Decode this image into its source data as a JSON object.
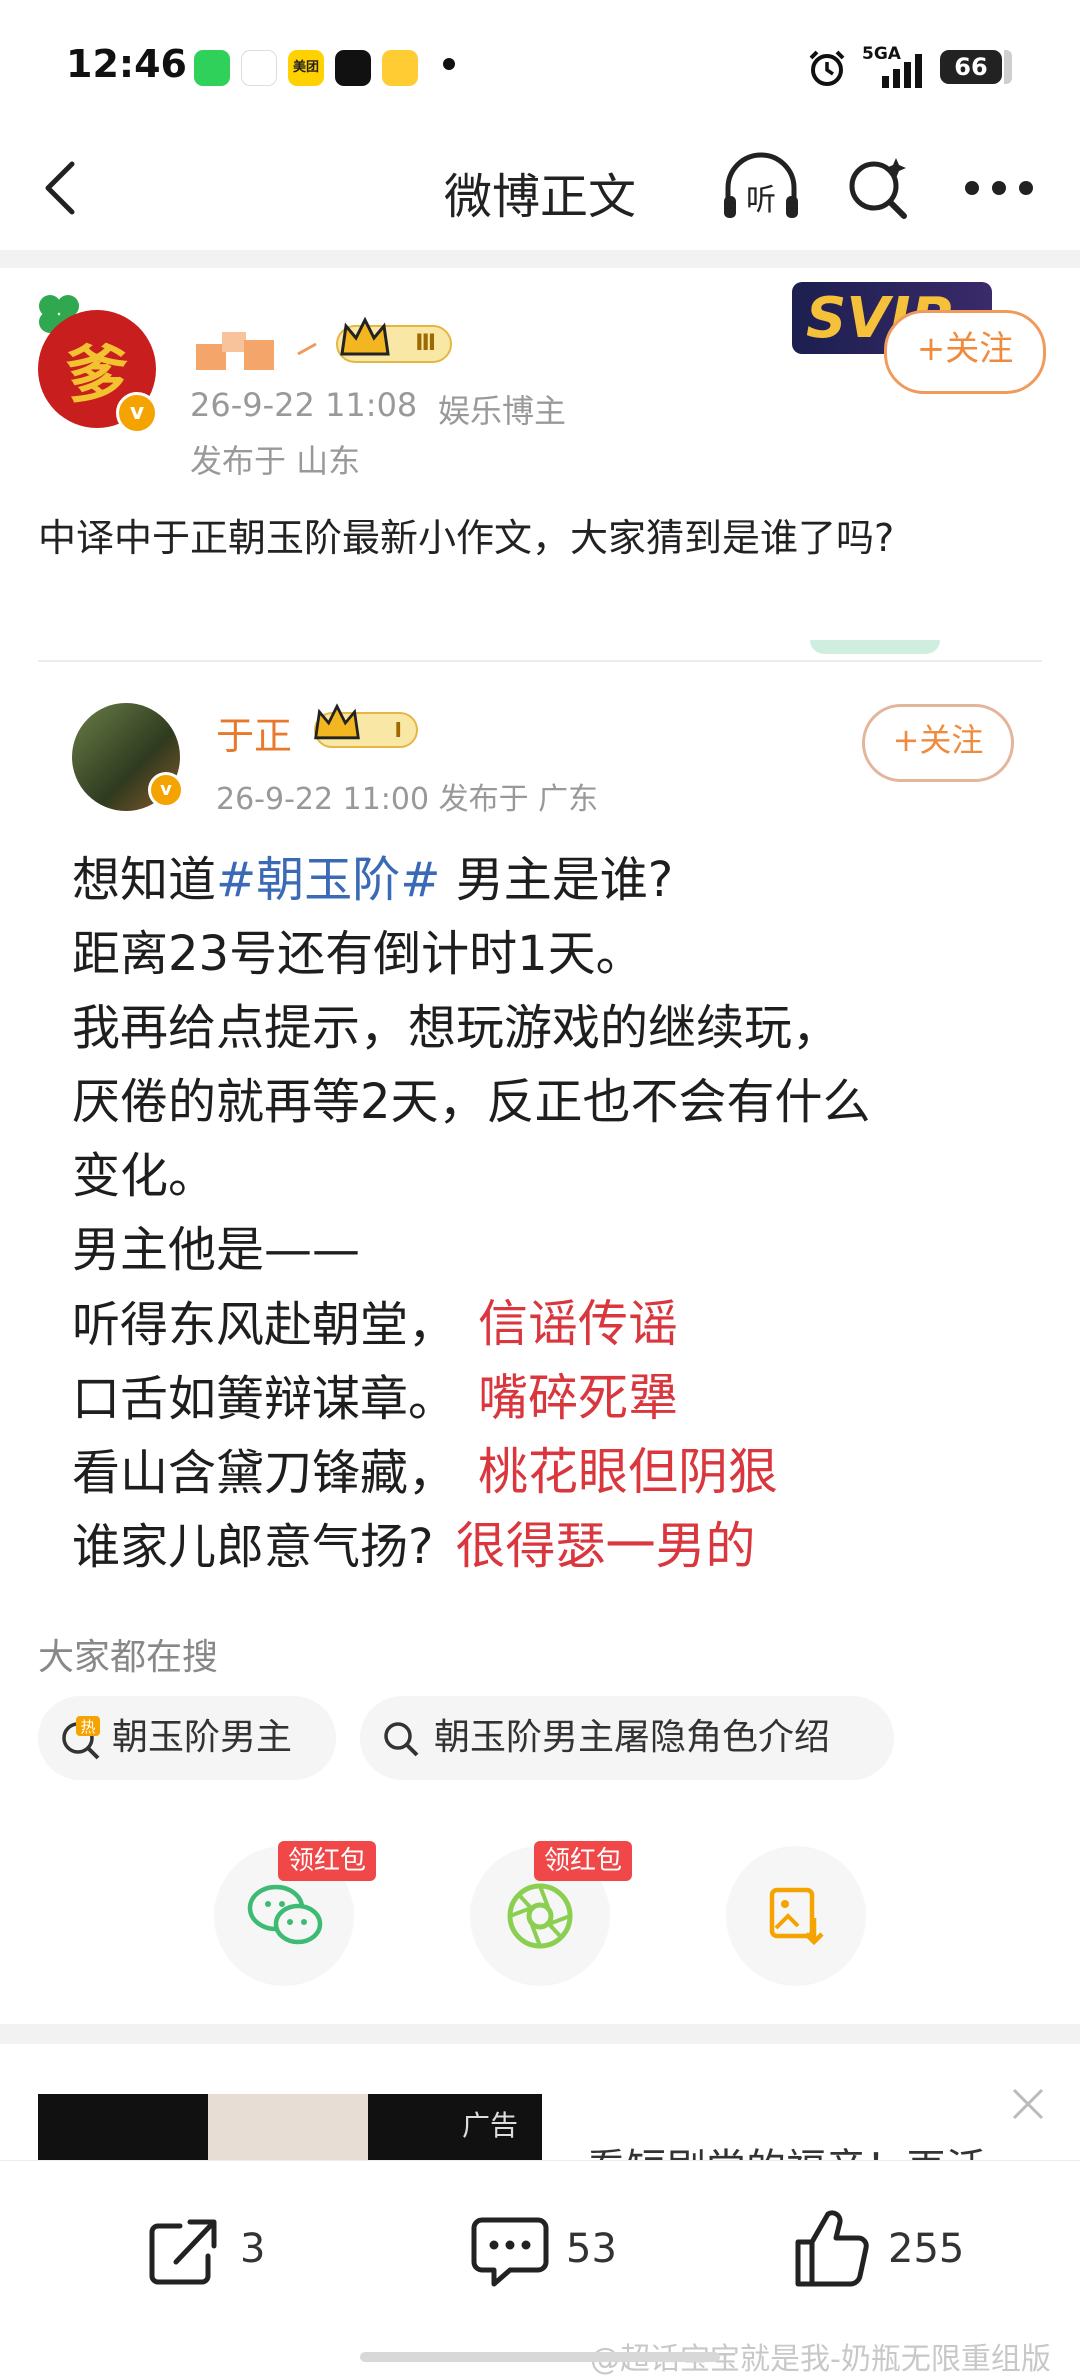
{
  "status_bar": {
    "time": "12:46",
    "app_icons": [
      {
        "name": "wechat-icon",
        "color": "#2fd15a",
        "label": ""
      },
      {
        "name": "telecom-icon",
        "color": "#ffffff",
        "label": ""
      },
      {
        "name": "meituan-icon",
        "color": "#ffd100",
        "label": "美团"
      },
      {
        "name": "tiktok-icon",
        "color": "#111111",
        "label": ""
      },
      {
        "name": "weibo-icon",
        "color": "#ffcc33",
        "label": ""
      }
    ],
    "network": "5GA",
    "battery": "66"
  },
  "nav": {
    "title": "微博正文"
  },
  "repost": {
    "author_date": "26-9-22 11:08",
    "author_tag": "娱乐博主",
    "location": "发布于 山东",
    "level_badge": "Ⅲ",
    "follow_label": "+关注",
    "text": "中译中于正朝玉阶最新小作文，大家猜到是谁了吗?",
    "vip_badge": "SVIP"
  },
  "original": {
    "author": "于正",
    "level_badge": "Ⅰ",
    "meta": "26-9-22 11:00  发布于 广东",
    "follow_label": "+关注",
    "lines": [
      {
        "pre": "想知道",
        "topic": "#朝玉阶#",
        "post": " 男主是谁?"
      },
      {
        "pre": "距离23号还有倒计时1天。"
      },
      {
        "pre": "我再给点提示，想玩游戏的继续玩，"
      },
      {
        "pre": "厌倦的就再等2天，反正也不会有什么"
      },
      {
        "pre": "变化。"
      },
      {
        "pre": "男主他是——"
      },
      {
        "pre": "听得东风赴朝堂，",
        "note": "信谣传谣"
      },
      {
        "pre": "口舌如簧辩谋章。",
        "note": "嘴碎死犟"
      },
      {
        "pre": "看山含黛刀锋藏，",
        "note": "桃花眼但阴狠"
      },
      {
        "pre": "谁家儿郎意气扬?",
        "note": "很得瑟一男的"
      }
    ]
  },
  "hot_search": {
    "title": "大家都在搜",
    "chips": [
      {
        "label": "朝玉阶男主",
        "icon": "hot-search-icon"
      },
      {
        "label": "朝玉阶男主屠隐角色介绍",
        "icon": "search-icon"
      }
    ]
  },
  "share": {
    "items": [
      {
        "name": "wechat-share",
        "badge": "领红包"
      },
      {
        "name": "moments-share",
        "badge": "领红包"
      },
      {
        "name": "save-image",
        "badge": ""
      }
    ]
  },
  "ad": {
    "label": "广告",
    "text": "看短剧尝的福音！再活"
  },
  "actions": {
    "repost_count": "3",
    "comment_count": "53",
    "like_count": "255"
  },
  "watermark": "@超话宝宝就是我-奶瓶无限重组版"
}
